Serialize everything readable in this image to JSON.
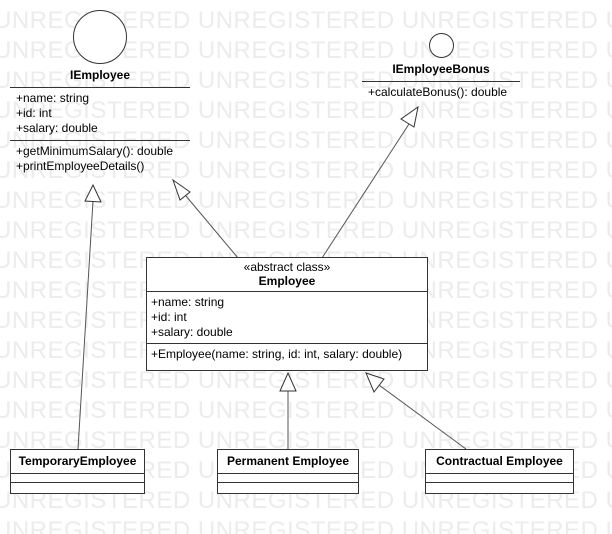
{
  "watermark": "UNREGISTERED UNREGISTERED UNREGISTERED UNREGISTERED",
  "iemployee": {
    "name": "IEmployee",
    "attributes": [
      "+name: string",
      "+id: int",
      "+salary: double"
    ],
    "operations": [
      "+getMinimumSalary(): double",
      "+printEmployeeDetails()"
    ]
  },
  "iemployee_bonus": {
    "name": "IEmployeeBonus",
    "operations": [
      "+calculateBonus(): double"
    ]
  },
  "employee": {
    "stereotype": "«abstract class»",
    "name": "Employee",
    "attributes": [
      "+name: string",
      "+id: int",
      "+salary: double"
    ],
    "operations": [
      "+Employee(name: string, id: int, salary: double)"
    ]
  },
  "temporary_employee": {
    "name": "TemporaryEmployee"
  },
  "permanent_employee": {
    "name": "Permanent Employee"
  },
  "contractual_employee": {
    "name": "Contractual Employee"
  }
}
